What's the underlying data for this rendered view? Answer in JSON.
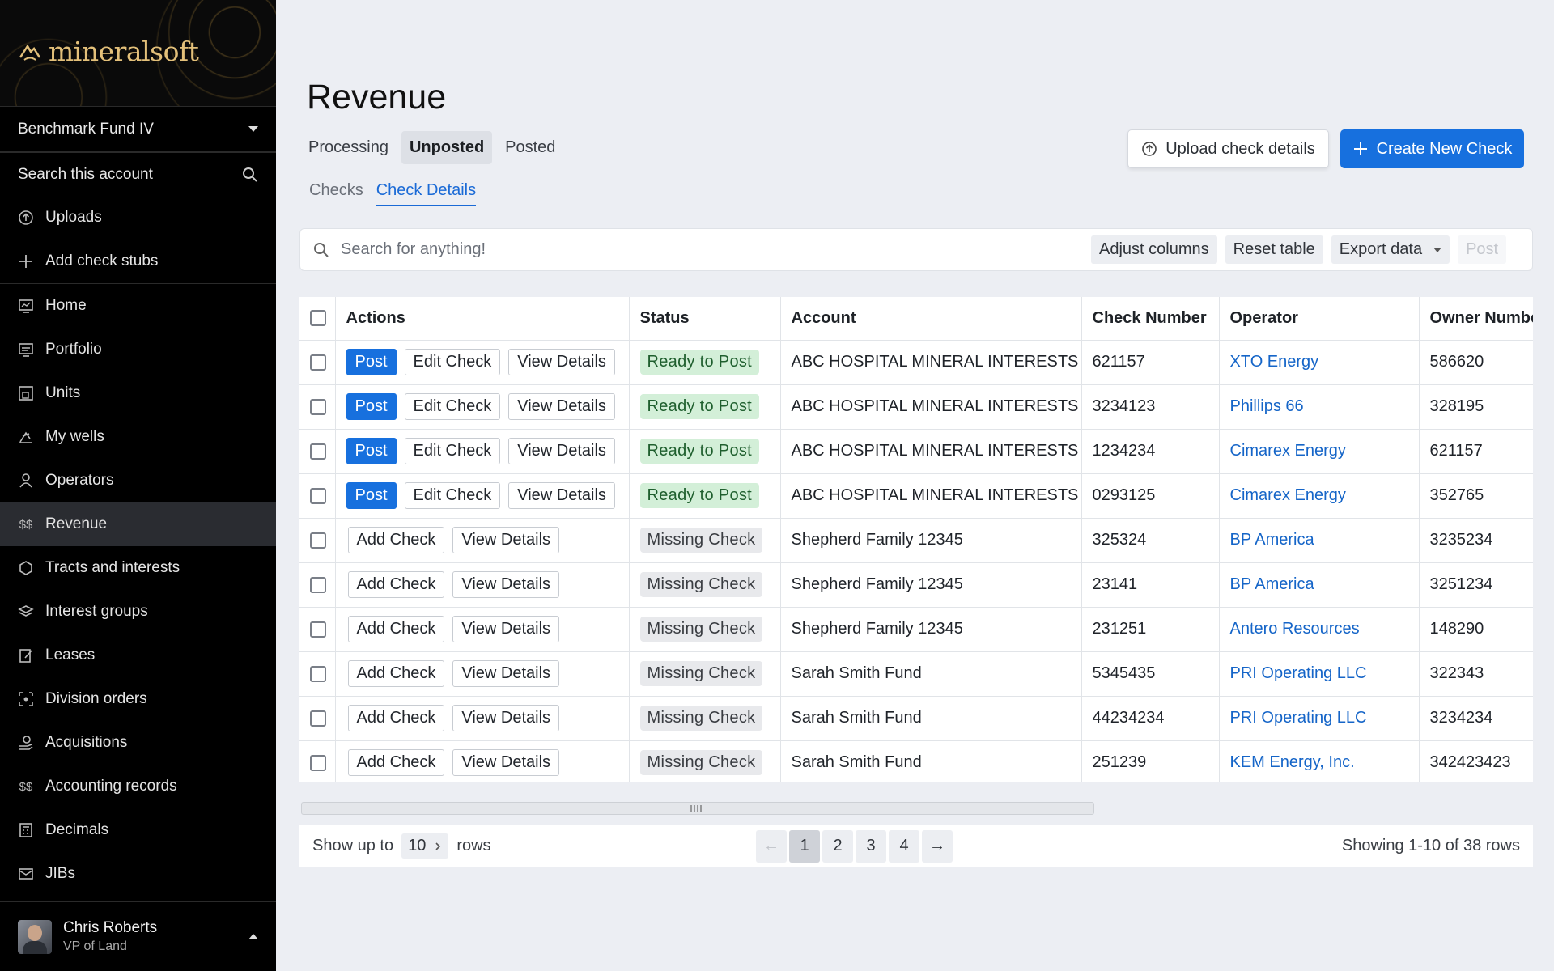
{
  "app": {
    "brand": "mineralsoft"
  },
  "sidebar": {
    "fund": "Benchmark Fund IV",
    "search_label": "Search this account",
    "items": [
      {
        "label": "Uploads",
        "icon": "upload-icon"
      },
      {
        "label": "Add check stubs",
        "icon": "plus-icon"
      },
      {
        "label": "Home",
        "icon": "home-icon"
      },
      {
        "label": "Portfolio",
        "icon": "portfolio-icon"
      },
      {
        "label": "Units",
        "icon": "units-icon"
      },
      {
        "label": "My wells",
        "icon": "wells-icon"
      },
      {
        "label": "Operators",
        "icon": "operators-icon"
      },
      {
        "label": "Revenue",
        "icon": "revenue-icon"
      },
      {
        "label": "Tracts and interests",
        "icon": "hexagon-icon"
      },
      {
        "label": "Interest groups",
        "icon": "layers-icon"
      },
      {
        "label": "Leases",
        "icon": "lease-icon"
      },
      {
        "label": "Division orders",
        "icon": "division-icon"
      },
      {
        "label": "Acquisitions",
        "icon": "acquisitions-icon"
      },
      {
        "label": "Accounting records",
        "icon": "accounting-icon"
      },
      {
        "label": "Decimals",
        "icon": "calculator-icon"
      },
      {
        "label": "JIBs",
        "icon": "jibs-icon"
      }
    ],
    "active_item": "Revenue",
    "user": {
      "name": "Chris Roberts",
      "role": "VP of Land"
    }
  },
  "header": {
    "title": "Revenue",
    "tabs": [
      {
        "label": "Processing",
        "active": false
      },
      {
        "label": "Unposted",
        "active": true
      },
      {
        "label": "Posted",
        "active": false
      }
    ],
    "subtabs": [
      {
        "label": "Checks",
        "active": false
      },
      {
        "label": "Check Details",
        "active": true
      }
    ],
    "upload_label": "Upload check details",
    "create_label": "Create New Check"
  },
  "toolbar": {
    "search_placeholder": "Search for anything!",
    "adjust_label": "Adjust columns",
    "reset_label": "Reset table",
    "export_label": "Export data",
    "post_label": "Post"
  },
  "table": {
    "columns": [
      "Actions",
      "Status",
      "Account",
      "Check Number",
      "Operator",
      "Owner Number"
    ],
    "action_labels": {
      "post": "Post",
      "edit": "Edit Check",
      "view": "View Details",
      "add": "Add Check"
    },
    "rows": [
      {
        "type": "ready",
        "status": "Ready to Post",
        "account": "ABC HOSPITAL MINERAL INTERESTS",
        "check": "621157",
        "operator": "XTO Energy",
        "owner": "586620"
      },
      {
        "type": "ready",
        "status": "Ready to Post",
        "account": "ABC HOSPITAL MINERAL INTERESTS",
        "check": "3234123",
        "operator": "Phillips 66",
        "owner": "328195"
      },
      {
        "type": "ready",
        "status": "Ready to Post",
        "account": "ABC HOSPITAL MINERAL INTERESTS",
        "check": "1234234",
        "operator": "Cimarex Energy",
        "owner": "621157"
      },
      {
        "type": "ready",
        "status": "Ready to Post",
        "account": "ABC HOSPITAL MINERAL INTERESTS",
        "check": "0293125",
        "operator": "Cimarex Energy",
        "owner": "352765"
      },
      {
        "type": "missing",
        "status": "Missing Check",
        "account": "Shepherd Family 12345",
        "check": "325324",
        "operator": "BP America",
        "owner": "3235234"
      },
      {
        "type": "missing",
        "status": "Missing Check",
        "account": "Shepherd Family 12345",
        "check": "23141",
        "operator": "BP America",
        "owner": "3251234"
      },
      {
        "type": "missing",
        "status": "Missing Check",
        "account": "Shepherd Family 12345",
        "check": "231251",
        "operator": "Antero Resources",
        "owner": "148290"
      },
      {
        "type": "missing",
        "status": "Missing Check",
        "account": "Sarah Smith Fund",
        "check": "5345435",
        "operator": "PRI Operating LLC",
        "owner": "322343"
      },
      {
        "type": "missing",
        "status": "Missing Check",
        "account": "Sarah Smith Fund",
        "check": "44234234",
        "operator": "PRI Operating LLC",
        "owner": "3234234"
      },
      {
        "type": "missing",
        "status": "Missing Check",
        "account": "Sarah Smith Fund",
        "check": "251239",
        "operator": "KEM Energy, Inc.",
        "owner": "342423423"
      }
    ]
  },
  "footer": {
    "show_label": "Show up to",
    "rows_value": "10",
    "rows_label": "rows",
    "pages": [
      "1",
      "2",
      "3",
      "4"
    ],
    "current_page": "1",
    "prev_label": "←",
    "next_label": "→",
    "showing": "Showing 1-10 of 38 rows"
  },
  "colors": {
    "accent": "#1770de",
    "ready_bg": "#d3efd8",
    "missing_bg": "#e8e9ec",
    "brand_gold": "#e3c07a"
  }
}
